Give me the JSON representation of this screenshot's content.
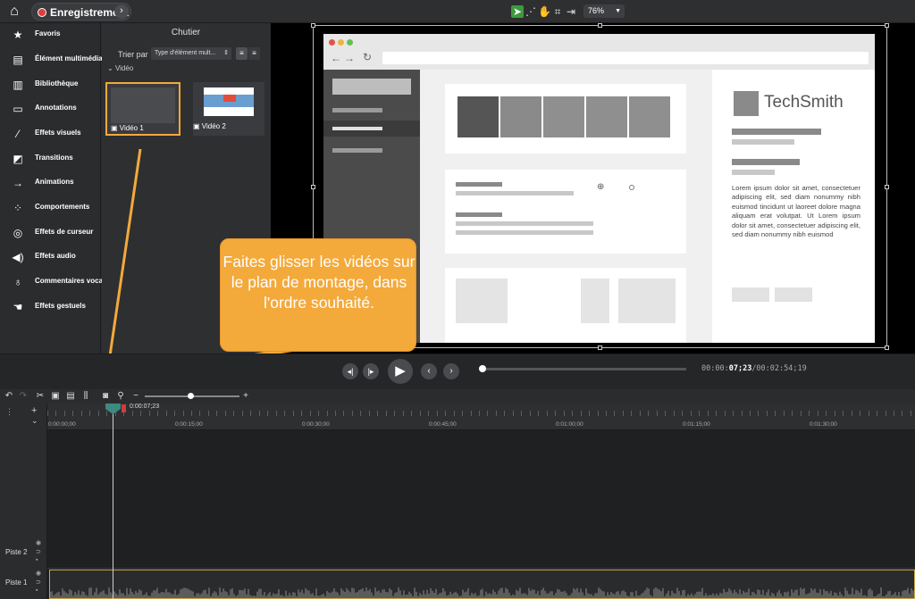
{
  "topbar": {
    "home_icon": "home-icon",
    "record_label": "Enregistrement",
    "zoom_value": "76%"
  },
  "sidebar": {
    "items": [
      {
        "label": "Favoris",
        "icon": "star-icon"
      },
      {
        "label": "Élément multimédia",
        "icon": "film-icon"
      },
      {
        "label": "Bibliothèque",
        "icon": "library-icon"
      },
      {
        "label": "Annotations",
        "icon": "annotation-icon"
      },
      {
        "label": "Effets visuels",
        "icon": "wand-icon"
      },
      {
        "label": "Transitions",
        "icon": "transition-icon"
      },
      {
        "label": "Animations",
        "icon": "animation-icon"
      },
      {
        "label": "Comportements",
        "icon": "behavior-icon"
      },
      {
        "label": "Effets de curseur",
        "icon": "cursor-icon"
      },
      {
        "label": "Effets audio",
        "icon": "speaker-icon"
      },
      {
        "label": "Commentaires vocaux",
        "icon": "microphone-icon"
      },
      {
        "label": "Effets gestuels",
        "icon": "hand-icon"
      }
    ]
  },
  "bin": {
    "title": "Chutier",
    "sort_label": "Trier par",
    "sort_value": "Type d'élément mult...",
    "group_label": "Vidéo",
    "items": [
      {
        "label": "Vidéo 1"
      },
      {
        "label": "Vidéo 2"
      }
    ]
  },
  "preview": {
    "logo_text": "TechSmith",
    "lorem": "Lorem ipsum dolor sit amet, consectetuer adipiscing elit, sed diam nonummy nibh euismod tincidunt ut laoreet dolore magna aliquam erat volutpat. Ut Lorem ipsum dolor sit amet, consectetuer adipiscing elit, sed diam nonummy nibh euismod"
  },
  "callout": {
    "text": "Faites glisser les vidéos sur le plan de montage, dans l'ordre souhaité.",
    "color": "#f4a93b"
  },
  "transport": {
    "time_prefix": "00:00:",
    "time_current": "07;23",
    "time_total": "/00:02:54;19",
    "progress": 0.0
  },
  "timeline": {
    "playhead_time": "0:00:07;23",
    "ruler_labels": [
      "0:00:00;00",
      "0:00:15;00",
      "0:00:30;00",
      "0:00:45;00",
      "0:01:00;00",
      "0:01:15;00",
      "0:01:30;00"
    ],
    "tracks": [
      {
        "label": "Piste 2"
      },
      {
        "label": "Piste 1"
      }
    ]
  }
}
